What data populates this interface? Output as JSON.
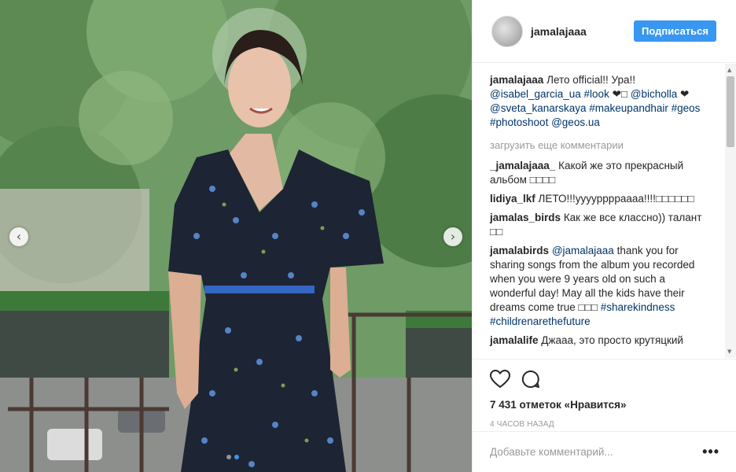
{
  "post": {
    "username": "jamalajaaa",
    "follow_label": "Подписаться",
    "caption": {
      "author": "jamalajaaa",
      "text": "Лето official!! Ура!! ",
      "tag1": "@isabel_garcia_ua",
      "tag2": "#look",
      "hearts1": " ❤□ ",
      "tag3": "@bicholla",
      "heart2": " ❤ ",
      "tag4": "@sveta_kanarskaya",
      "tag5": "#makeupandhair",
      "tag6": "#geos",
      "tag7": "#photoshoot",
      "tag8": "@geos.ua"
    },
    "load_more": "загрузить еще комментарии",
    "comments": [
      {
        "author": "_jamalajaaa_",
        "text": " Какой же это прекрасный альбом □□□□"
      },
      {
        "author": "lidiya_lkf",
        "text": " ЛЕТО!!!yyyyppppaaaa!!!!□□□□□□"
      },
      {
        "author": "jamalas_birds",
        "text": " Как же все классно)) талант □□"
      },
      {
        "author": "jamalabirds",
        "mention": "@jamalajaaa",
        "text": " thank you for sharing songs from the album you recorded when you were 9 years old on such a wonderful day! May all the kids have their dreams come true □□□ ",
        "tag1": "#sharekindness",
        "tag2": "#childrenarethefuture"
      },
      {
        "author": "jamalalife",
        "text": " Джааа, это просто крутяцкий"
      }
    ],
    "likes": "7 431 отметок «Нравится»",
    "time_ago": "4 часов назад",
    "comment_placeholder": "Добавьте комментарий...",
    "more_label": "•••",
    "prev_glyph": "‹",
    "next_glyph": "›",
    "scroll_up": "▲",
    "scroll_down": "▼",
    "carousel_dots": 2,
    "active_dot": 1
  },
  "icons": {
    "like": "heart-icon",
    "comment": "comment-bubble-icon"
  },
  "colors": {
    "accent": "#3897f0",
    "link": "#003569",
    "muted": "#999999"
  }
}
